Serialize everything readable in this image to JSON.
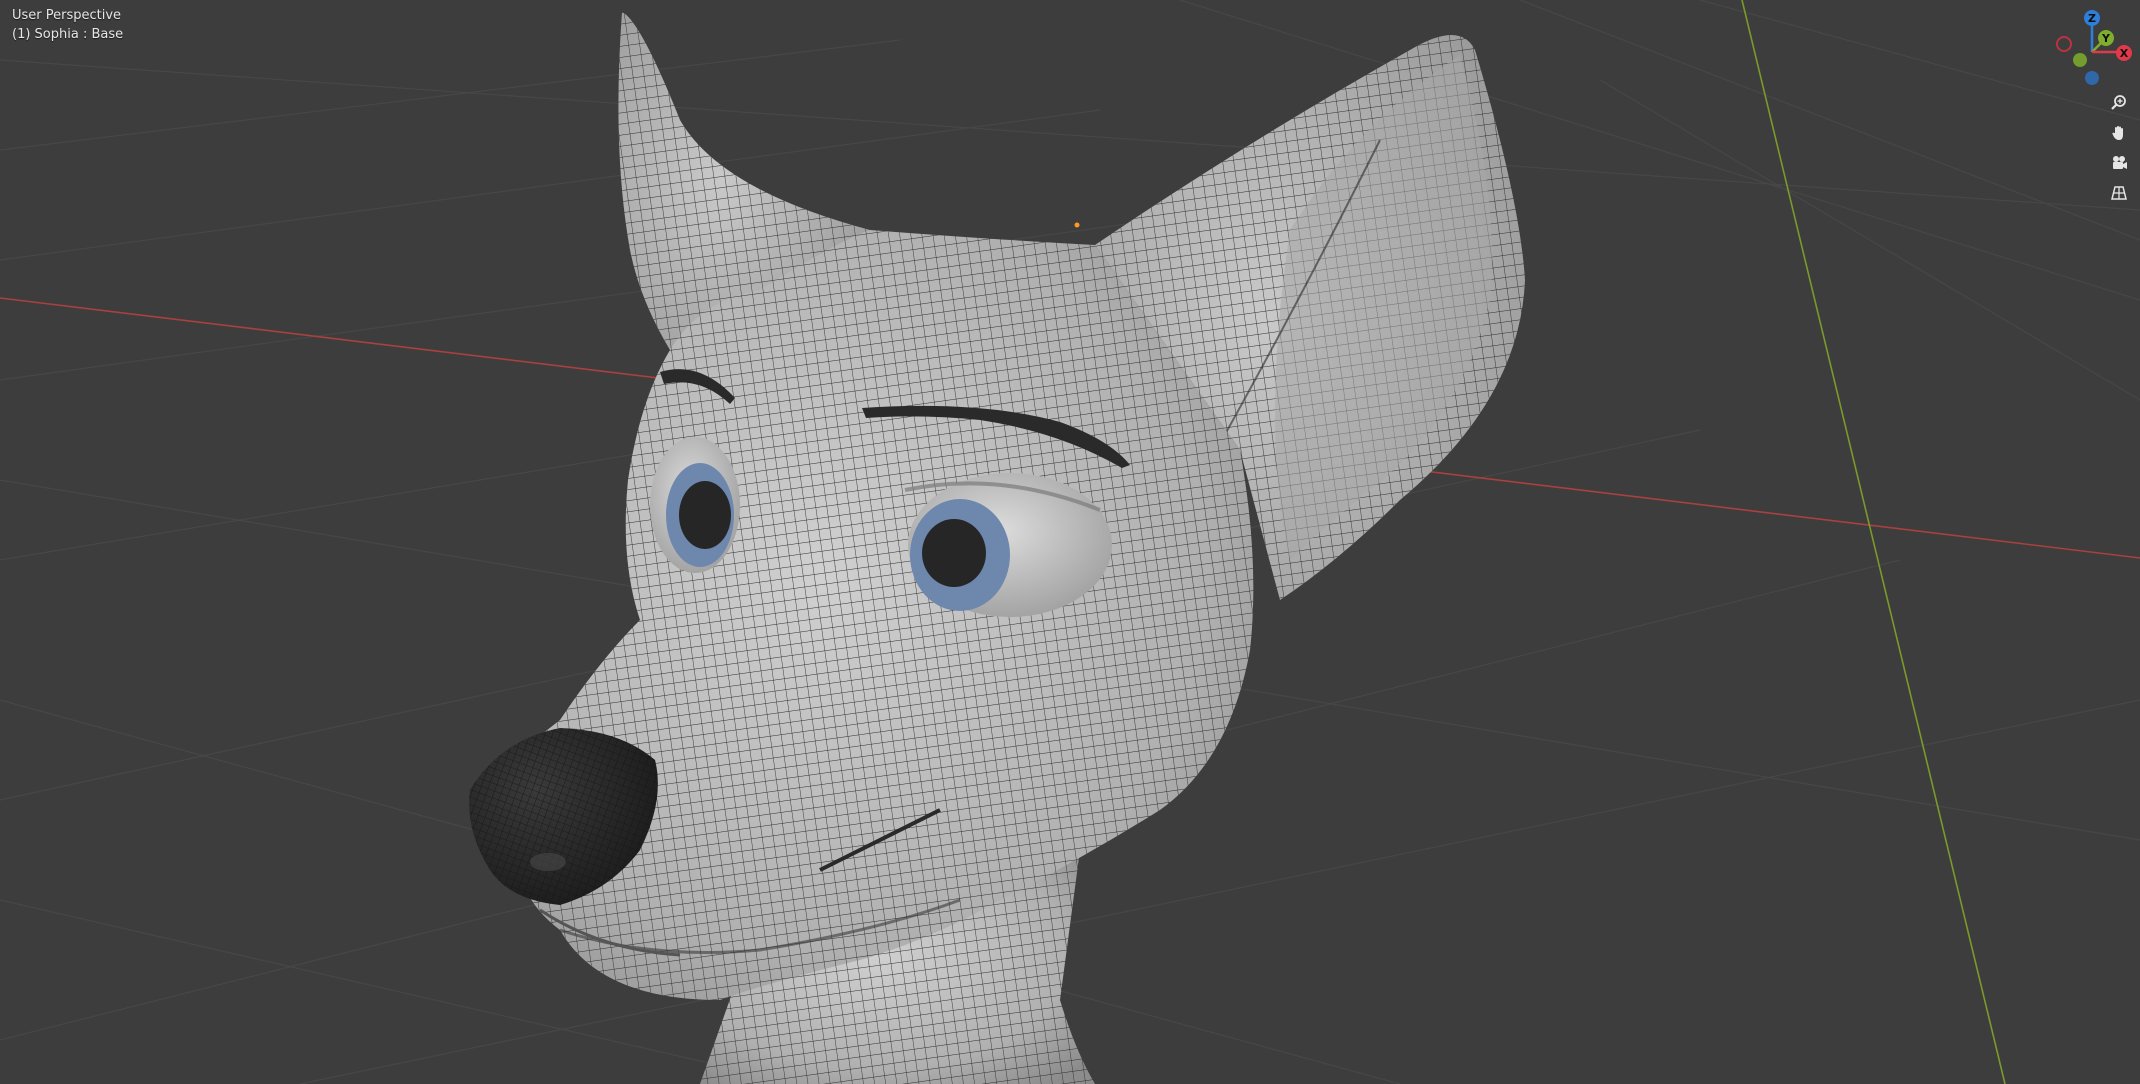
{
  "viewport": {
    "view_name": "User Perspective",
    "object_info": "(1) Sophia : Base"
  },
  "gizmo": {
    "z_label": "Z",
    "y_label": "Y",
    "x_label": "X"
  },
  "navigation_tools": [
    {
      "name": "zoom-icon"
    },
    {
      "name": "pan-hand-icon"
    },
    {
      "name": "camera-view-icon"
    },
    {
      "name": "perspective-toggle-icon"
    }
  ],
  "colors": {
    "background": "#3d3d3d",
    "grid": "#4a4a4a",
    "x_axis": "#a8413f",
    "y_axis": "#7a9a2a",
    "x_gizmo": "#e0394a",
    "y_gizmo": "#7fae2c",
    "z_gizmo": "#2e7fd9",
    "mesh": "#bdbdbd",
    "nose": "#2c2c2c",
    "iris": "#6e87ad",
    "pupil": "#262626",
    "origin": "#ff9a1f"
  }
}
